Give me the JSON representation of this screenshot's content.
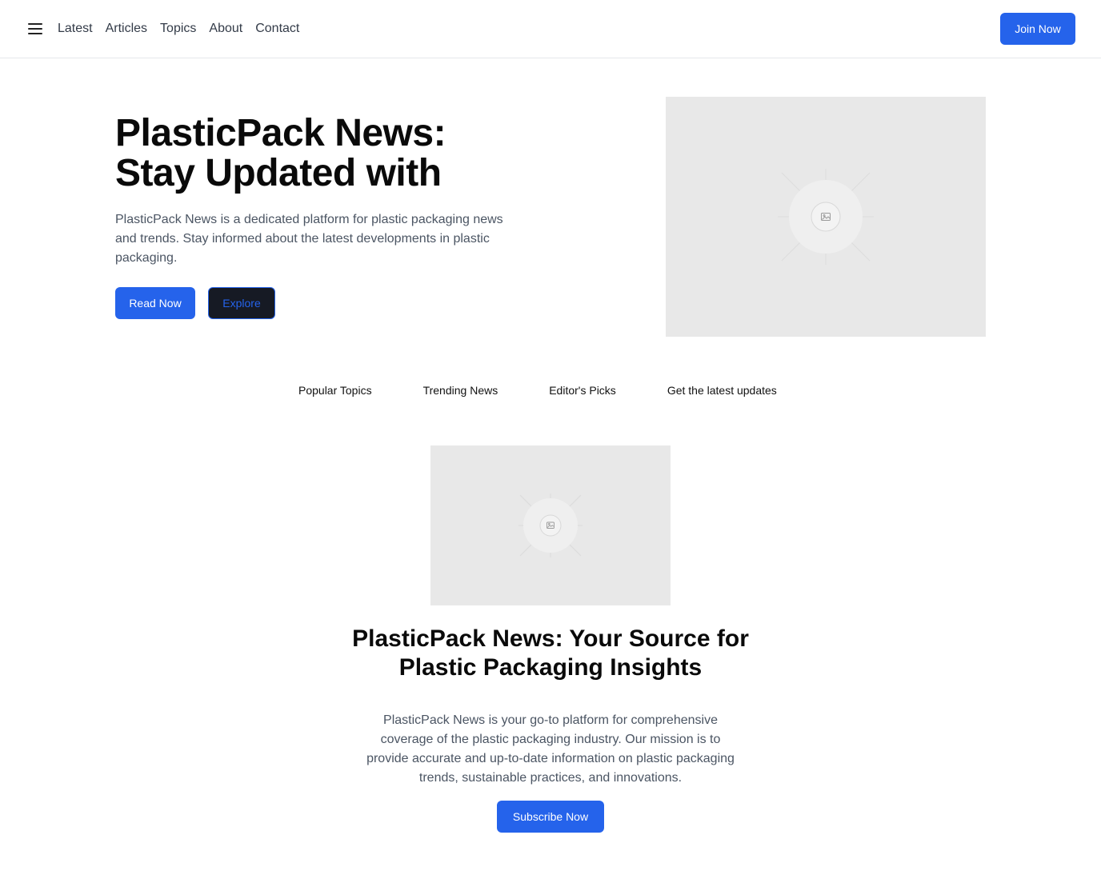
{
  "header": {
    "menu_icon": "hamburger-menu-icon",
    "nav": [
      "Latest",
      "Articles",
      "Topics",
      "About",
      "Contact"
    ],
    "join_label": "Join Now"
  },
  "hero": {
    "title": "PlasticPack News: Stay Updated with",
    "description": "PlasticPack News is a dedicated platform for plastic packaging news and trends. Stay informed about the latest developments in plastic packaging.",
    "read_label": "Read Now",
    "explore_label": "Explore",
    "image_icon": "image-placeholder-icon"
  },
  "topics": [
    "Popular Topics",
    "Trending News",
    "Editor's Picks",
    "Get the latest updates"
  ],
  "feature": {
    "image_icon": "image-placeholder-icon",
    "title": "PlasticPack News: Your Source for Plastic Packaging Insights",
    "description": "PlasticPack News is your go-to platform for comprehensive coverage of the plastic packaging industry. Our mission is to provide accurate and up-to-date information on plastic packaging trends, sustainable practices, and innovations.",
    "subscribe_label": "Subscribe Now"
  },
  "colors": {
    "accent": "#2563eb",
    "placeholder_bg": "#e8e8e8",
    "text_muted": "#4b5563"
  }
}
